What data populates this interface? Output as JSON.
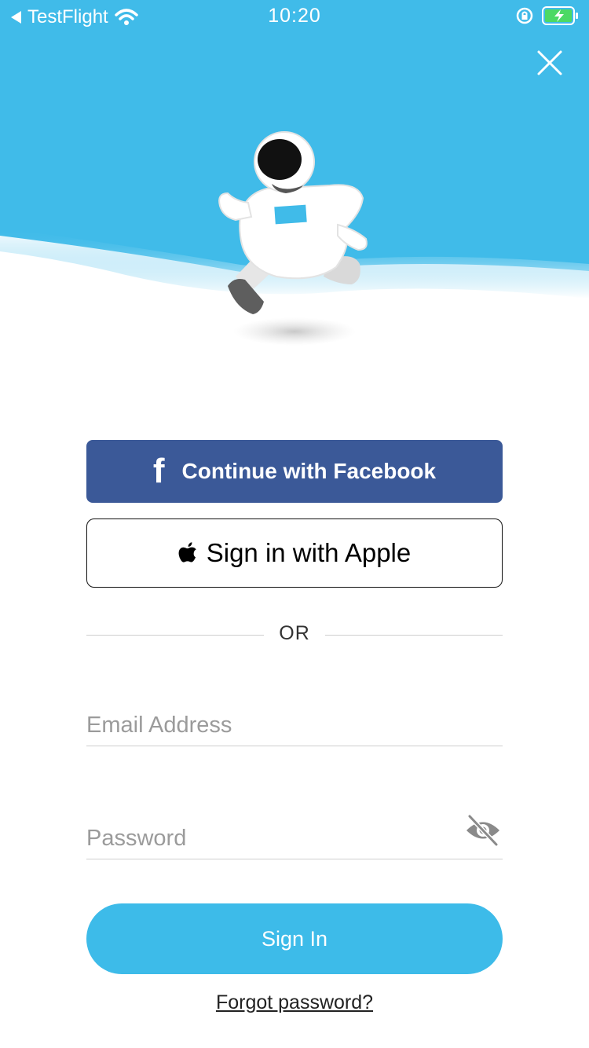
{
  "status_bar": {
    "back_app": "TestFlight",
    "time": "10:20"
  },
  "colors": {
    "sky": "#40bbe9",
    "facebook": "#3b5998",
    "primary": "#3dbbe9"
  },
  "icons": {
    "close": "close-icon",
    "facebook": "facebook-icon",
    "apple": "apple-icon",
    "eye": "eye-slash-icon",
    "mascot": "astronaut-illustration"
  },
  "auth": {
    "facebook_label": "Continue with Facebook",
    "facebook_glyph": "f",
    "apple_label": "Sign in with Apple",
    "divider": "OR"
  },
  "form": {
    "email_placeholder": "Email Address",
    "password_placeholder": "Password",
    "signin_label": "Sign In",
    "forgot_label": "Forgot password?"
  }
}
